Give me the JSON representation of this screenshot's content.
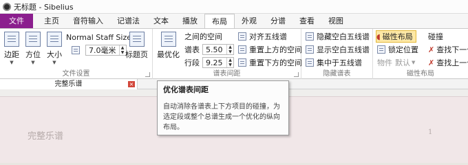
{
  "window": {
    "title": "无标题 - Sibelius"
  },
  "ribbon_tabs": [
    "文件",
    "主页",
    "音符输入",
    "记谱法",
    "文本",
    "播放",
    "布局",
    "外观",
    "分谱",
    "查看",
    "视图"
  ],
  "active_tab": "布局",
  "groups": {
    "document_setup": {
      "label": "文件设置",
      "buttons": {
        "margins": "边距",
        "orientation": "方位",
        "size": "大小",
        "title_page": "标题页"
      },
      "staff_size_label": "Normal Staff Size",
      "staff_size_value": "7.0毫米"
    },
    "staff_spacing": {
      "label": "谱表间距",
      "optimize": "最优化",
      "between_spaces": "之间的空间",
      "staves_label": "谱表",
      "staves_value": "5.50",
      "systems_label": "行段",
      "systems_value": "9.25",
      "align_staves": "对齐五线谱",
      "reset_above": "重置上方的空间",
      "reset_below": "重置下方的空间"
    },
    "hide_staves": {
      "label": "隐藏谱表",
      "hide_empty": "隐藏空白五线谱",
      "show_empty": "显示空白五线谱",
      "focus_on_staves": "集中于五线谱"
    },
    "magnetic_layout": {
      "label": "磁性布局",
      "magnetic_layout": "磁性布局",
      "lock_position": "锁定位置",
      "object_label": "物件",
      "object_value": "默认",
      "collisions": "碰撞",
      "find_next": "查找下一个",
      "find_prev": "查找上一个"
    }
  },
  "doc_tab": {
    "label": "完整乐谱",
    "close": "×"
  },
  "score": {
    "title": "完整乐谱",
    "page_number": "1"
  },
  "tooltip": {
    "title": "优化谱表间距",
    "body": "自动消除各谱表上下方项目的碰撞，为选定段或整个总谱生成一个优化的纵向布局。"
  },
  "colors": {
    "file_tab": "#8b1e8e",
    "paper": "#f1e7e8",
    "magnetic_highlight": "#fde8a6"
  }
}
